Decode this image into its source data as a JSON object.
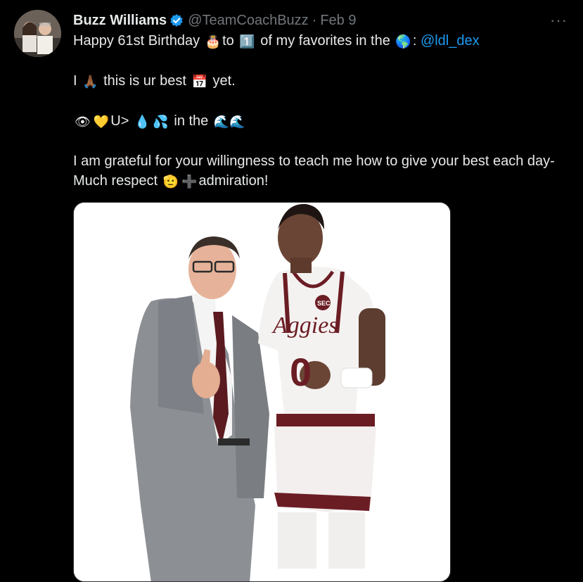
{
  "tweet": {
    "author_name": "Buzz Williams",
    "handle": "@TeamCoachBuzz",
    "separator": "·",
    "date": "Feb 9",
    "more_label": "···",
    "line1_pre": "Happy 61st Birthday ",
    "line1_emoji_cake": "🎂",
    "line1_to": "to ",
    "line1_emoji_one": "1️⃣",
    "line1_mid": " of my favorites in the ",
    "line1_emoji_globe": "🌎",
    "line1_colon": ": ",
    "mention": "@ldl_dex",
    "line2_pre": "I ",
    "line2_emoji_pray": "🙏🏾",
    "line2_mid": " this is ur best ",
    "line2_emoji_calendar": "📅",
    "line2_post": " yet.",
    "line3_emoji_eye": "👁",
    "line3_emoji_heart": "💛",
    "line3_text": "U> ",
    "line3_emoji_drop": "💧",
    "line3_emoji_sweat": "💦",
    "line3_mid": " in the ",
    "line3_emoji_waves": "🌊🌊",
    "line4_pre": "I am grateful for your willingness to teach me how to give your best each day-Much respect ",
    "line4_emoji_salute": "🫡",
    "line4_emoji_plus": "➕",
    "line4_post": "admiration!"
  },
  "photo": {
    "jersey_text": "Aggies",
    "jersey_number": "0",
    "logo_text": "SEC"
  },
  "colors": {
    "background": "#000000",
    "text": "#e7e9ea",
    "muted": "#71767b",
    "link": "#1d9bf0",
    "verified": "#1d9bf0",
    "maroon": "#6b1d24"
  }
}
